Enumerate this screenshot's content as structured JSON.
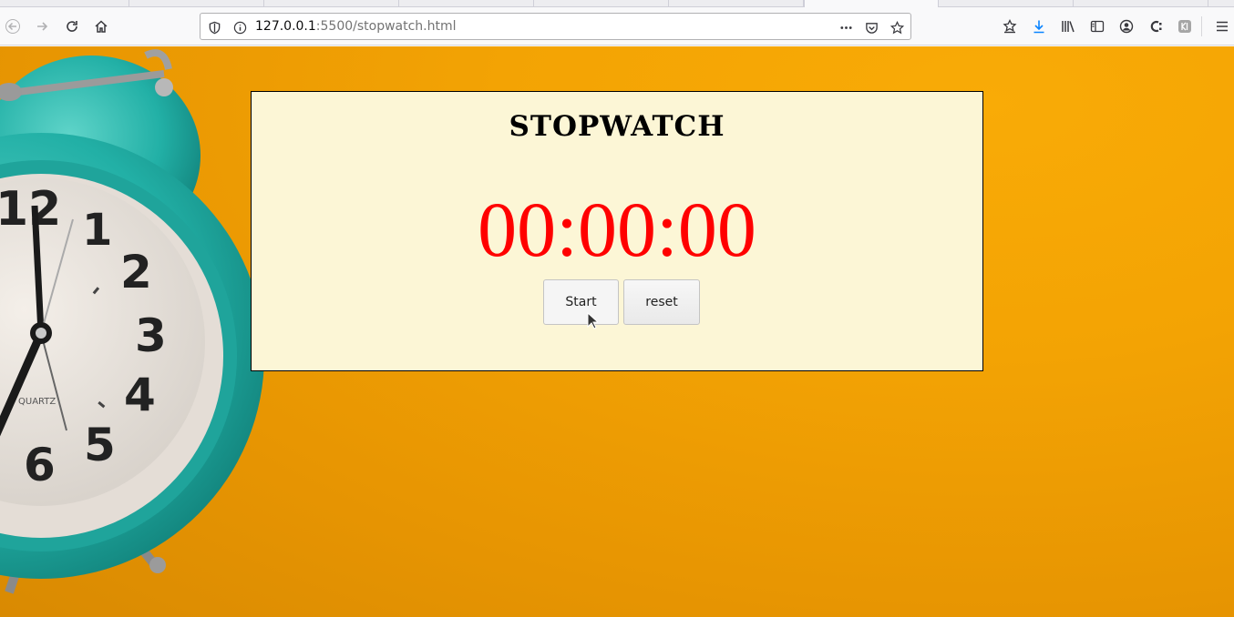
{
  "browser": {
    "url_host": "127.0.0.1",
    "url_path": ":5500/stopwatch.html",
    "icons": [
      "back-icon",
      "forward-icon",
      "reload-icon",
      "home-icon",
      "shield-icon",
      "info-icon",
      "more-icon",
      "pocket-icon",
      "bookmark-star-icon",
      "bookmarks-toolbar-icon",
      "download-icon",
      "library-icon",
      "sidebar-icon",
      "account-icon",
      "extension-icon",
      "extension2-icon",
      "menu-icon"
    ]
  },
  "stopwatch": {
    "title": "STOPWATCH",
    "time": "00:00:00",
    "start_label": "Start",
    "reset_label": "reset"
  },
  "colors": {
    "background": "#f3a304",
    "card": "#fcf6d6",
    "timer": "#ff0000",
    "clock_teal": "#25b6ad"
  }
}
